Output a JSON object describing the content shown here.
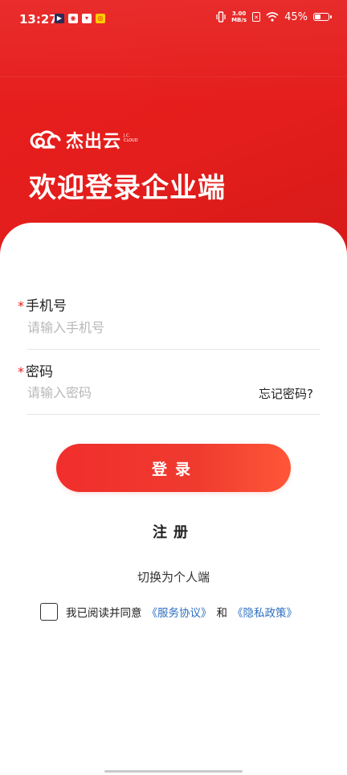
{
  "status_bar": {
    "time": "13:27",
    "net_speed_value": "3.00",
    "net_speed_unit": "MB/s",
    "battery": "45%",
    "battery_level": 0.45
  },
  "header": {
    "logo_name": "杰出云",
    "logo_sub_line1": "J.C.",
    "logo_sub_line2": "CLOUD",
    "welcome": "欢迎登录企业端"
  },
  "form": {
    "required_mark": "*",
    "phone_label": "手机号",
    "phone_placeholder": "请输入手机号",
    "password_label": "密码",
    "password_placeholder": "请输入密码",
    "forgot_password": "忘记密码?"
  },
  "actions": {
    "login": "登录",
    "register": "注册",
    "switch_mode": "切换为个人端"
  },
  "agreement": {
    "prefix": "我已阅读并同意",
    "service_link": "《服务协议》",
    "conjunction": "和",
    "privacy_link": "《隐私政策》",
    "checked": false
  },
  "colors": {
    "brand_red": "#e41e1c",
    "link_blue": "#2d6fc0"
  }
}
